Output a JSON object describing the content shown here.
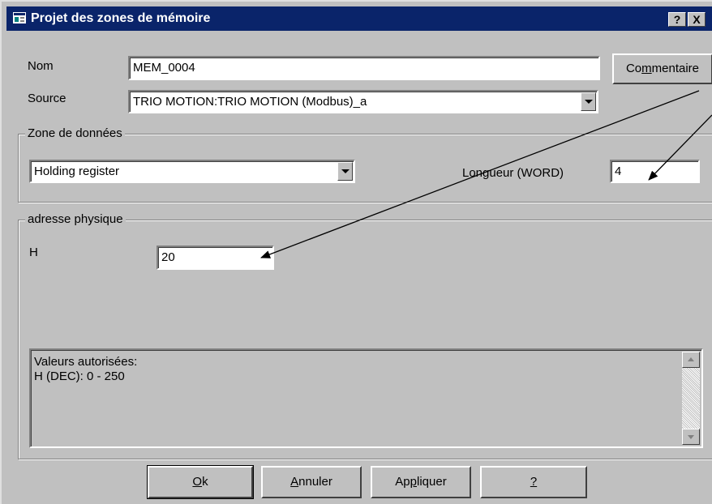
{
  "window": {
    "title": "Projet des zones de mémoire",
    "help_button": "?",
    "close_button": "X"
  },
  "fields": {
    "nom_label": "Nom",
    "nom_value": "MEM_0004",
    "source_label": "Source",
    "source_value": "TRIO MOTION:TRIO MOTION (Modbus)_a",
    "commentaire_pre": "Co",
    "commentaire_u": "m",
    "commentaire_post": "mentaire"
  },
  "zone": {
    "title": "Zone de données",
    "type_value": "Holding register",
    "length_label": "Longueur (WORD)",
    "length_value": "4"
  },
  "address": {
    "title": "adresse physique",
    "h_label": "H",
    "h_value": "20"
  },
  "info": {
    "line1": "Valeurs autorisées:",
    "line2": "H (DEC): 0 - 250"
  },
  "buttons": {
    "ok_u": "O",
    "ok_post": "k",
    "cancel_u": "A",
    "cancel_post": "nnuler",
    "apply_pre": "Ap",
    "apply_u": "p",
    "apply_post": "liquer",
    "help_u": "?"
  }
}
